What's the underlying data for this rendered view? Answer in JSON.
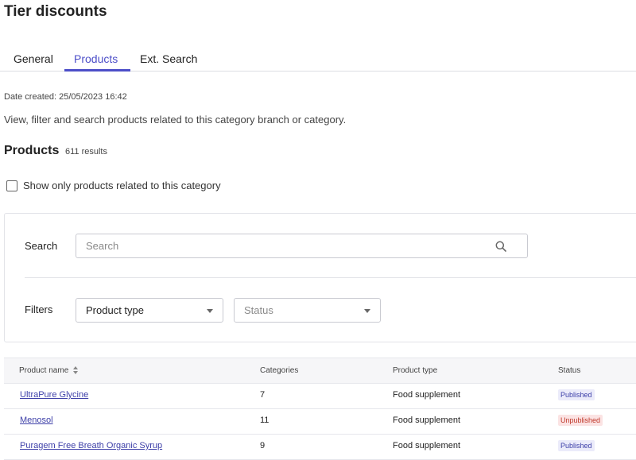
{
  "page": {
    "title": "Tier discounts"
  },
  "tabs": [
    {
      "label": "General",
      "active": false
    },
    {
      "label": "Products",
      "active": true
    },
    {
      "label": "Ext. Search",
      "active": false
    }
  ],
  "meta": {
    "date_created": "Date created: 25/05/2023 16:42",
    "description": "View, filter and search products related to this category branch or category."
  },
  "products": {
    "heading": "Products",
    "results": "611 results",
    "checkbox_label": "Show only products related to this category",
    "checkbox_checked": false
  },
  "filters": {
    "search_label": "Search",
    "search_placeholder": "Search",
    "search_value": "",
    "filters_label": "Filters",
    "product_type": "Product type",
    "status": "Status"
  },
  "table": {
    "headers": [
      "Product name",
      "Categories",
      "Product type",
      "Status"
    ],
    "rows": [
      {
        "name": "UltraPure Glycine",
        "categories": "7",
        "type": "Food supplement",
        "status": "Published"
      },
      {
        "name": "Menosol",
        "categories": "11",
        "type": "Food supplement",
        "status": "Unpublished"
      },
      {
        "name": "Puragem Free Breath Organic Syrup",
        "categories": "9",
        "type": "Food supplement",
        "status": "Published"
      }
    ]
  },
  "colors": {
    "accent": "#4c4ec8",
    "published_bg": "#ebebfa",
    "unpublished_bg": "#fbe3e3",
    "unpublished_text": "#c0392b"
  }
}
